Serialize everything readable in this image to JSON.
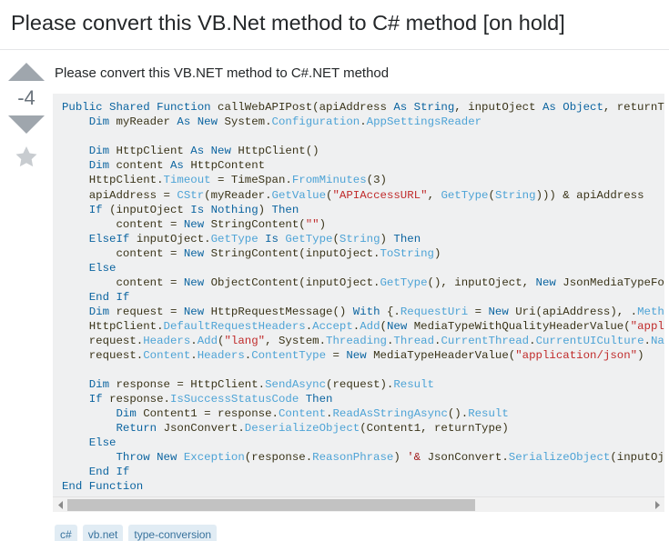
{
  "page": {
    "title": "Please convert this VB.Net method to C# method [on hold]"
  },
  "post": {
    "vote": {
      "up_icon": "triangle-up-icon",
      "down_icon": "triangle-down-icon",
      "score": "-4",
      "favorite_icon": "star-icon"
    },
    "body_intro": "Please convert this VB.NET method to C#.NET method",
    "code_language": "vb.net",
    "code_lines": [
      [
        {
          "t": "Public Shared Function ",
          "c": "kw"
        },
        {
          "t": "callWebAPIPost(apiAddress ",
          "c": "plain"
        },
        {
          "t": "As String",
          "c": "kw"
        },
        {
          "t": ", inputOject ",
          "c": "plain"
        },
        {
          "t": "As Object",
          "c": "kw"
        },
        {
          "t": ", returnType",
          "c": "plain"
        }
      ],
      [
        {
          "t": "    ",
          "c": "plain"
        },
        {
          "t": "Dim ",
          "c": "kw"
        },
        {
          "t": "myReader ",
          "c": "plain"
        },
        {
          "t": "As New ",
          "c": "kw"
        },
        {
          "t": "System.",
          "c": "plain"
        },
        {
          "t": "Configuration",
          "c": "typ"
        },
        {
          "t": ".",
          "c": "plain"
        },
        {
          "t": "AppSettingsReader",
          "c": "typ"
        }
      ],
      [],
      [
        {
          "t": "    ",
          "c": "plain"
        },
        {
          "t": "Dim ",
          "c": "kw"
        },
        {
          "t": "HttpClient ",
          "c": "plain"
        },
        {
          "t": "As New ",
          "c": "kw"
        },
        {
          "t": "HttpClient()",
          "c": "plain"
        }
      ],
      [
        {
          "t": "    ",
          "c": "plain"
        },
        {
          "t": "Dim ",
          "c": "kw"
        },
        {
          "t": "content ",
          "c": "plain"
        },
        {
          "t": "As ",
          "c": "kw"
        },
        {
          "t": "HttpContent",
          "c": "plain"
        }
      ],
      [
        {
          "t": "    HttpClient.",
          "c": "plain"
        },
        {
          "t": "Timeout",
          "c": "typ"
        },
        {
          "t": " = TimeSpan.",
          "c": "plain"
        },
        {
          "t": "FromMinutes",
          "c": "typ"
        },
        {
          "t": "(3)",
          "c": "plain"
        }
      ],
      [
        {
          "t": "    apiAddress = ",
          "c": "plain"
        },
        {
          "t": "CStr",
          "c": "typ"
        },
        {
          "t": "(myReader.",
          "c": "plain"
        },
        {
          "t": "GetValue",
          "c": "typ"
        },
        {
          "t": "(",
          "c": "plain"
        },
        {
          "t": "\"APIAccessURL\"",
          "c": "str"
        },
        {
          "t": ", ",
          "c": "plain"
        },
        {
          "t": "GetType",
          "c": "typ"
        },
        {
          "t": "(",
          "c": "plain"
        },
        {
          "t": "String",
          "c": "typ"
        },
        {
          "t": "))) & apiAddress",
          "c": "plain"
        }
      ],
      [
        {
          "t": "    ",
          "c": "plain"
        },
        {
          "t": "If ",
          "c": "kw"
        },
        {
          "t": "(inputOject ",
          "c": "plain"
        },
        {
          "t": "Is Nothing",
          "c": "kw"
        },
        {
          "t": ") ",
          "c": "plain"
        },
        {
          "t": "Then",
          "c": "kw"
        }
      ],
      [
        {
          "t": "        content = ",
          "c": "plain"
        },
        {
          "t": "New ",
          "c": "kw"
        },
        {
          "t": "StringContent(",
          "c": "plain"
        },
        {
          "t": "\"\"",
          "c": "str"
        },
        {
          "t": ")",
          "c": "plain"
        }
      ],
      [
        {
          "t": "    ",
          "c": "plain"
        },
        {
          "t": "ElseIf ",
          "c": "kw"
        },
        {
          "t": "inputOject.",
          "c": "plain"
        },
        {
          "t": "GetType ",
          "c": "typ"
        },
        {
          "t": "Is ",
          "c": "kw"
        },
        {
          "t": "GetType",
          "c": "typ"
        },
        {
          "t": "(",
          "c": "plain"
        },
        {
          "t": "String",
          "c": "typ"
        },
        {
          "t": ") ",
          "c": "plain"
        },
        {
          "t": "Then",
          "c": "kw"
        }
      ],
      [
        {
          "t": "        content = ",
          "c": "plain"
        },
        {
          "t": "New ",
          "c": "kw"
        },
        {
          "t": "StringContent(inputOject.",
          "c": "plain"
        },
        {
          "t": "ToString",
          "c": "typ"
        },
        {
          "t": ")",
          "c": "plain"
        }
      ],
      [
        {
          "t": "    ",
          "c": "plain"
        },
        {
          "t": "Else",
          "c": "kw"
        }
      ],
      [
        {
          "t": "        content = ",
          "c": "plain"
        },
        {
          "t": "New ",
          "c": "kw"
        },
        {
          "t": "ObjectContent(inputOject.",
          "c": "plain"
        },
        {
          "t": "GetType",
          "c": "typ"
        },
        {
          "t": "(), inputOject, ",
          "c": "plain"
        },
        {
          "t": "New ",
          "c": "kw"
        },
        {
          "t": "JsonMediaTypeForma",
          "c": "plain"
        }
      ],
      [
        {
          "t": "    ",
          "c": "plain"
        },
        {
          "t": "End If",
          "c": "kw"
        }
      ],
      [
        {
          "t": "    ",
          "c": "plain"
        },
        {
          "t": "Dim ",
          "c": "kw"
        },
        {
          "t": "request = ",
          "c": "plain"
        },
        {
          "t": "New ",
          "c": "kw"
        },
        {
          "t": "HttpRequestMessage() ",
          "c": "plain"
        },
        {
          "t": "With ",
          "c": "kw"
        },
        {
          "t": "{.",
          "c": "plain"
        },
        {
          "t": "RequestUri",
          "c": "typ"
        },
        {
          "t": " = ",
          "c": "plain"
        },
        {
          "t": "New ",
          "c": "kw"
        },
        {
          "t": "Uri(apiAddress), .",
          "c": "plain"
        },
        {
          "t": "Method",
          "c": "typ"
        }
      ],
      [
        {
          "t": "    HttpClient.",
          "c": "plain"
        },
        {
          "t": "DefaultRequestHeaders",
          "c": "typ"
        },
        {
          "t": ".",
          "c": "plain"
        },
        {
          "t": "Accept",
          "c": "typ"
        },
        {
          "t": ".",
          "c": "plain"
        },
        {
          "t": "Add",
          "c": "typ"
        },
        {
          "t": "(",
          "c": "plain"
        },
        {
          "t": "New ",
          "c": "kw"
        },
        {
          "t": "MediaTypeWithQualityHeaderValue(",
          "c": "plain"
        },
        {
          "t": "\"applica",
          "c": "str"
        }
      ],
      [
        {
          "t": "    request.",
          "c": "plain"
        },
        {
          "t": "Headers",
          "c": "typ"
        },
        {
          "t": ".",
          "c": "plain"
        },
        {
          "t": "Add",
          "c": "typ"
        },
        {
          "t": "(",
          "c": "plain"
        },
        {
          "t": "\"lang\"",
          "c": "str"
        },
        {
          "t": ", System.",
          "c": "plain"
        },
        {
          "t": "Threading",
          "c": "typ"
        },
        {
          "t": ".",
          "c": "plain"
        },
        {
          "t": "Thread",
          "c": "typ"
        },
        {
          "t": ".",
          "c": "plain"
        },
        {
          "t": "CurrentThread",
          "c": "typ"
        },
        {
          "t": ".",
          "c": "plain"
        },
        {
          "t": "CurrentUICulture",
          "c": "typ"
        },
        {
          "t": ".",
          "c": "plain"
        },
        {
          "t": "Name",
          "c": "typ"
        },
        {
          "t": ")",
          "c": "plain"
        }
      ],
      [
        {
          "t": "    request.",
          "c": "plain"
        },
        {
          "t": "Content",
          "c": "typ"
        },
        {
          "t": ".",
          "c": "plain"
        },
        {
          "t": "Headers",
          "c": "typ"
        },
        {
          "t": ".",
          "c": "plain"
        },
        {
          "t": "ContentType",
          "c": "typ"
        },
        {
          "t": " = ",
          "c": "plain"
        },
        {
          "t": "New ",
          "c": "kw"
        },
        {
          "t": "MediaTypeHeaderValue(",
          "c": "plain"
        },
        {
          "t": "\"application/json\"",
          "c": "str"
        },
        {
          "t": ")",
          "c": "plain"
        }
      ],
      [],
      [
        {
          "t": "    ",
          "c": "plain"
        },
        {
          "t": "Dim ",
          "c": "kw"
        },
        {
          "t": "response = HttpClient.",
          "c": "plain"
        },
        {
          "t": "SendAsync",
          "c": "typ"
        },
        {
          "t": "(request).",
          "c": "plain"
        },
        {
          "t": "Result",
          "c": "typ"
        }
      ],
      [
        {
          "t": "    ",
          "c": "plain"
        },
        {
          "t": "If ",
          "c": "kw"
        },
        {
          "t": "response.",
          "c": "plain"
        },
        {
          "t": "IsSuccessStatusCode ",
          "c": "typ"
        },
        {
          "t": "Then",
          "c": "kw"
        }
      ],
      [
        {
          "t": "        ",
          "c": "plain"
        },
        {
          "t": "Dim ",
          "c": "kw"
        },
        {
          "t": "Content1 = response.",
          "c": "plain"
        },
        {
          "t": "Content",
          "c": "typ"
        },
        {
          "t": ".",
          "c": "plain"
        },
        {
          "t": "ReadAsStringAsync",
          "c": "typ"
        },
        {
          "t": "().",
          "c": "plain"
        },
        {
          "t": "Result",
          "c": "typ"
        }
      ],
      [
        {
          "t": "        ",
          "c": "plain"
        },
        {
          "t": "Return ",
          "c": "kw"
        },
        {
          "t": "JsonConvert.",
          "c": "plain"
        },
        {
          "t": "DeserializeObject",
          "c": "typ"
        },
        {
          "t": "(Content1, returnType)",
          "c": "plain"
        }
      ],
      [
        {
          "t": "    ",
          "c": "plain"
        },
        {
          "t": "Else",
          "c": "kw"
        }
      ],
      [
        {
          "t": "        ",
          "c": "plain"
        },
        {
          "t": "Throw New ",
          "c": "kw"
        },
        {
          "t": "Exception",
          "c": "typ"
        },
        {
          "t": "(response.",
          "c": "plain"
        },
        {
          "t": "ReasonPhrase",
          "c": "typ"
        },
        {
          "t": ") ",
          "c": "plain"
        },
        {
          "t": "'& ",
          "c": "cmt"
        },
        {
          "t": "JsonConvert.",
          "c": "plain"
        },
        {
          "t": "SerializeObject",
          "c": "typ"
        },
        {
          "t": "(inputOject",
          "c": "plain"
        }
      ],
      [
        {
          "t": "    ",
          "c": "plain"
        },
        {
          "t": "End If",
          "c": "kw"
        }
      ],
      [
        {
          "t": "End Function",
          "c": "kw"
        }
      ]
    ],
    "scrollbar": {
      "left_arrow_icon": "caret-left-icon",
      "right_arrow_icon": "caret-right-icon",
      "thumb_fraction": 0.7
    },
    "tags": [
      "c#",
      "vb.net",
      "type-conversion"
    ]
  },
  "colors": {
    "code_background": "#eff0f1",
    "keyword": "#0b64a0",
    "type": "#4da3d6",
    "string": "#c02b2b",
    "comment": "#a11d1d",
    "tag_background": "#e1ecf4",
    "tag_text": "#39739d",
    "vote_arrow": "#9fa6ad",
    "vote_count_text": "#6a737c"
  }
}
